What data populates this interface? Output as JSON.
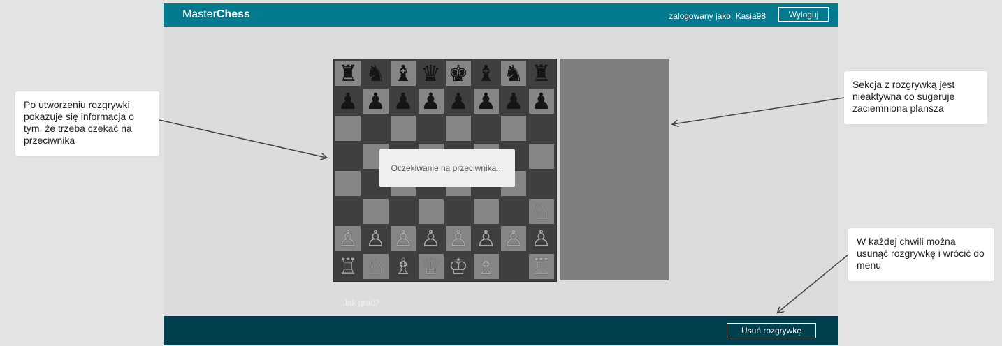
{
  "header": {
    "logo_light": "Master",
    "logo_bold": "Chess",
    "user_label": "zalogowany jako: Kasia98",
    "logout_label": "Wyloguj"
  },
  "board": {
    "black_back_rank": [
      "♜",
      "♞",
      "♝",
      "♛",
      "♚",
      "♝",
      "♞",
      "♜"
    ],
    "black_pawns": [
      "♟",
      "♟",
      "♟",
      "♟",
      "♟",
      "♟",
      "♟",
      "♟"
    ],
    "white_knight_row6": "♘",
    "white_pawns": [
      "♙",
      "♙",
      "♙",
      "♙",
      "♙",
      "♙",
      "♙",
      "♙"
    ],
    "white_back_rank": [
      "♖",
      "♘",
      "♗",
      "♕",
      "♔",
      "♗",
      "",
      "♖"
    ]
  },
  "modal": {
    "text": "Oczekiwanie na przeciwnika..."
  },
  "help_link": "Jak grać?",
  "footer": {
    "delete_label": "Usuń rozgrywkę"
  },
  "annotations": {
    "left": "Po utworzeniu rozgrywki pokazuje się informacja o tym, że trzeba czekać na przeciwnika",
    "right_top": "Sekcja z rozgrywką jest nieaktywna co sugeruje zaciemniona plansza",
    "right_bottom": "W każdej chwili można usunąć rozgrywkę i wrócić do menu"
  },
  "colors": {
    "header_bg": "#037a8e",
    "footer_bg": "#003f4e",
    "board_dark": "#3f3f3f",
    "board_light": "#858585"
  }
}
